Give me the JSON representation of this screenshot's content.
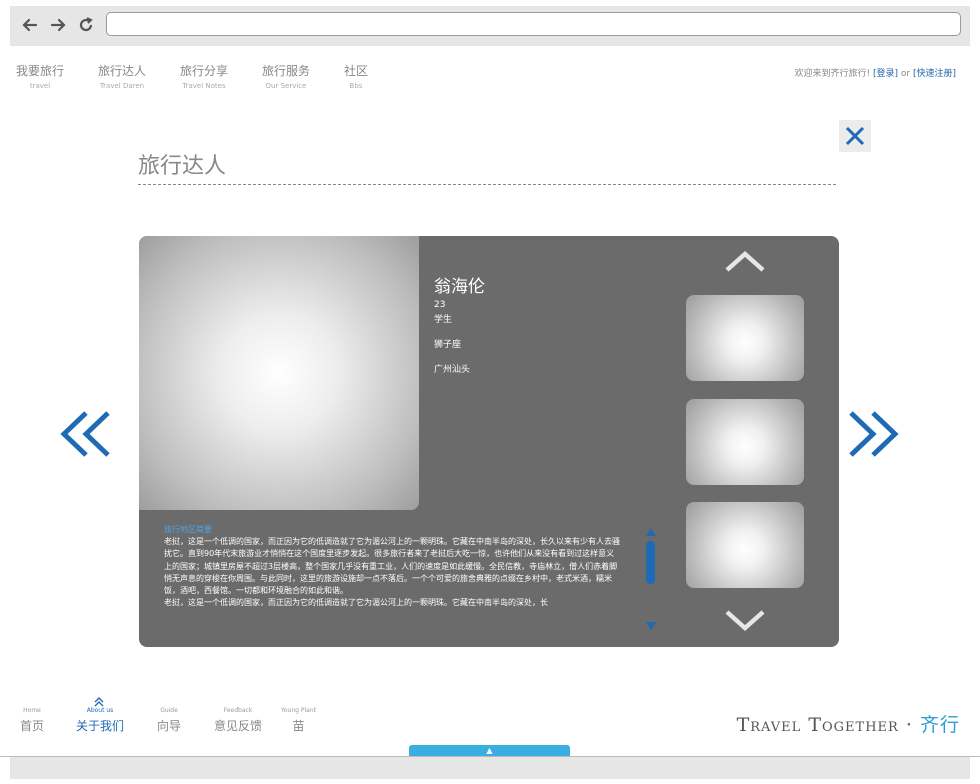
{
  "browser": {
    "back_icon": "arrow-left-icon",
    "forward_icon": "arrow-right-icon",
    "reload_icon": "reload-icon",
    "url": ""
  },
  "topnav": {
    "items": [
      {
        "zh": "我要旅行",
        "en": "travel"
      },
      {
        "zh": "旅行达人",
        "en": "Travel Daren"
      },
      {
        "zh": "旅行分享",
        "en": "Travel Notes"
      },
      {
        "zh": "旅行服务",
        "en": "Our Service"
      },
      {
        "zh": "社区",
        "en": "Bbs"
      }
    ],
    "welcome": "欢迎来到齐行旅行!",
    "login": "[登录]",
    "or": "or",
    "register": "[快速注册]"
  },
  "page": {
    "title": "旅行达人",
    "close_label": "✕"
  },
  "profile": {
    "name": "翁海伦",
    "age": "23",
    "occupation": "学生",
    "zodiac": "狮子座",
    "location": "广州汕头",
    "text_heading": "旅行地区简要",
    "text_body": "老挝，这是一个低调的国家，而正因为它的低调造就了它为湄公河上的一颗明珠。它藏在中南半岛的深处，长久以来有少有人去骚扰它。直到90年代末旅游业才悄悄在这个国度里逐步发起。很多旅行者来了老挝后大吃一惊，也许他们从来没有看到过这样意义上的国家；城镇里房屋不超过3层楼高，整个国家几乎没有重工业，人们的速度是如此缓慢。全民信教，寺庙林立，僧人们赤着脚悄无声息的穿梭在你周围。与此同时，这里的旅游设施却一点不落后。一个个可爱的旅舍典雅的点缀在乡村中，老式米酒，糯米饭，酒吧，西餐馆。一切都和环境融合的如此和谐。\n老挝，这是一个低调的国家，而正因为它的低调造就了它为湄公河上的一颗明珠。它藏在中南半岛的深处，长"
  },
  "footer": {
    "items": [
      {
        "en": "Home",
        "zh": "首页"
      },
      {
        "en": "About us",
        "zh": "关于我们"
      },
      {
        "en": "Guide",
        "zh": "向导"
      },
      {
        "en": "Feedback",
        "zh": "意见反馈"
      },
      {
        "en": "Young Plant",
        "zh": "苗"
      }
    ],
    "brand_en": "Travel Together",
    "brand_dot": "·",
    "brand_cn": "齐行",
    "handle_label": "▲"
  },
  "colors": {
    "accent": "#1e6ab4",
    "panel": "#6b6b6b",
    "brand_cn": "#2a9fd6"
  }
}
